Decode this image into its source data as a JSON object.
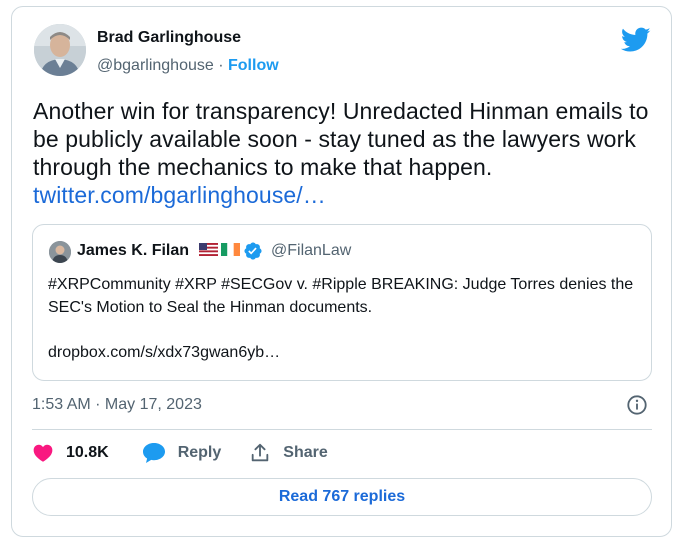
{
  "author": {
    "name": "Brad Garlinghouse",
    "handle": "@bgarlinghouse",
    "separator": "·",
    "follow_label": "Follow"
  },
  "tweet": {
    "text": "Another win for transparency! Unredacted Hinman emails to be publicly available soon - stay tuned as the lawyers work through the mechanics to make that happen.",
    "link": "twitter.com/bgarlinghouse/…"
  },
  "quoted_tweet": {
    "name": "James K. Filan",
    "handle": "@FilanLaw",
    "text": "#XRPCommunity #XRP #SECGov v. #Ripple BREAKING:  Judge Torres denies the SEC's Motion to Seal the Hinman documents.",
    "link": "dropbox.com/s/xdx73gwan6yb…"
  },
  "timestamp": "1:53 AM · May 17, 2023",
  "actions": {
    "like_count": "10.8K",
    "reply_label": "Reply",
    "share_label": "Share"
  },
  "read_replies_label": "Read 767 replies",
  "icons": {
    "brand": "twitter-bird-icon",
    "like": "heart-icon",
    "reply": "chat-bubble-icon",
    "share": "share-icon",
    "info": "info-icon",
    "verified": "verified-badge-icon"
  },
  "colors": {
    "accent": "#1d9bf0",
    "link": "#1b6ad8",
    "like": "#f91880",
    "secondary_text": "#536471",
    "border": "#cfd9de"
  }
}
